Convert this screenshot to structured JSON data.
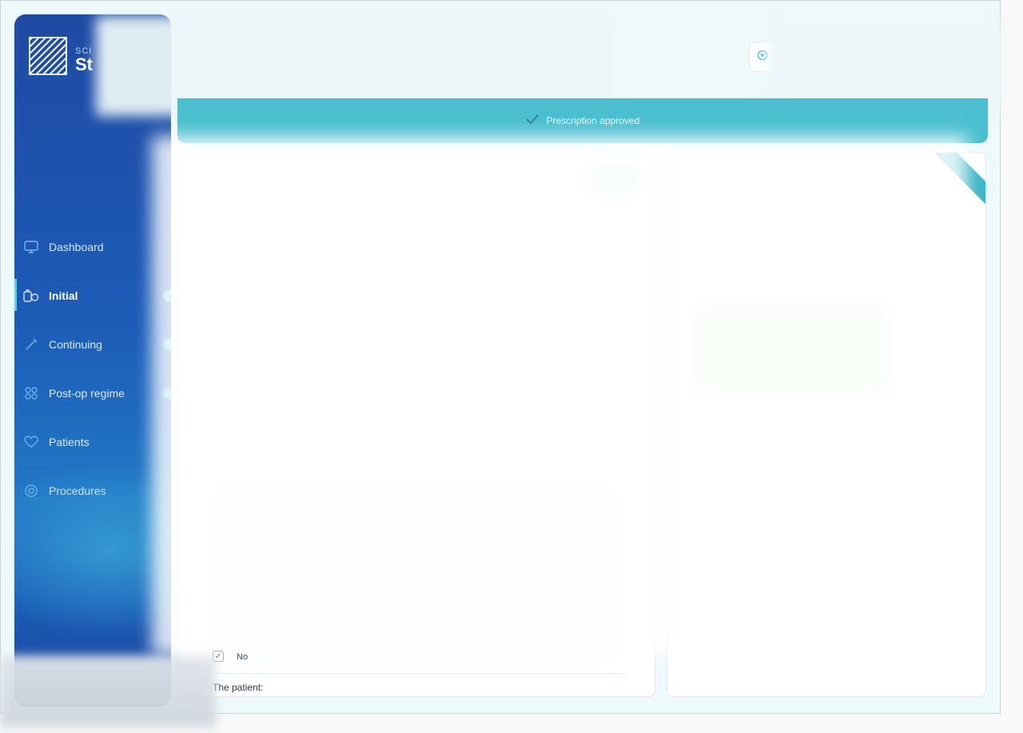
{
  "app": {
    "logo_small": "SCI",
    "logo_big": "St"
  },
  "sidebar": {
    "items": [
      {
        "label": "Dashboard",
        "icon": "monitor-icon",
        "active": false,
        "has_dot": false
      },
      {
        "label": "Initial",
        "icon": "pills-icon",
        "active": true,
        "has_dot": true
      },
      {
        "label": "Continuing",
        "icon": "syringe-icon",
        "active": false,
        "has_dot": true
      },
      {
        "label": "Post-op regime",
        "icon": "bandage-icon",
        "active": false,
        "has_dot": true
      },
      {
        "label": "Patients",
        "icon": "heart-icon",
        "active": false,
        "has_dot": false
      },
      {
        "label": "Procedures",
        "icon": "target-icon",
        "active": false,
        "has_dot": false
      }
    ]
  },
  "banner": {
    "text": "Prescription approved",
    "icon": "check-icon",
    "color": "#4bbfd0"
  },
  "form": {
    "checkbox_label": "No",
    "patient_label": "The patient:"
  },
  "colors": {
    "sidebar": "#1f4aa3",
    "accent": "#4fc3d9"
  }
}
